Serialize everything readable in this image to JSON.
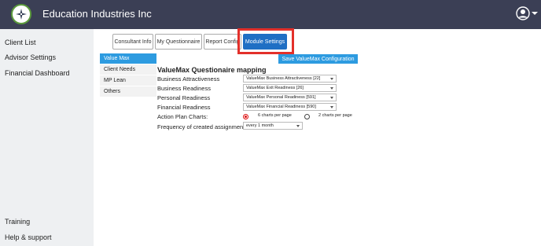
{
  "app": {
    "title": "Education Industries Inc"
  },
  "sidebar": {
    "items": [
      {
        "label": "Client List"
      },
      {
        "label": "Advisor Settings"
      },
      {
        "label": "Financial Dashboard"
      }
    ],
    "bottom_items": [
      {
        "label": "Training"
      },
      {
        "label": "Help & support"
      }
    ]
  },
  "tabs": [
    {
      "label": "Consultant Info"
    },
    {
      "label": "My Questionnaire"
    },
    {
      "label": "Report Config"
    },
    {
      "label": "Module Settings",
      "active": true
    }
  ],
  "subnav": [
    {
      "label": "Value Max",
      "active": true
    },
    {
      "label": "Client Needs"
    },
    {
      "label": "MP Lean"
    },
    {
      "label": "Others"
    }
  ],
  "main": {
    "save_label": "Save ValueMax Configuration",
    "section_title": "ValueMax Questionaire mapping",
    "mappings": [
      {
        "label": "Business Attractiveness",
        "value": "ValueMax Business Attractiveness [22]"
      },
      {
        "label": "Business Readiness",
        "value": "ValueMax Exit Readiness [26]"
      },
      {
        "label": "Personal Readiness",
        "value": "ValueMax Personal Readiness [591]"
      },
      {
        "label": "Financial Readiness",
        "value": "ValueMax Financial Readiness [590]"
      }
    ],
    "action_plan": {
      "label": "Action Plan Charts:",
      "options": [
        {
          "label": "6 charts per page",
          "checked": true
        },
        {
          "label": "2 charts per page",
          "checked": false
        }
      ]
    },
    "frequency": {
      "label": "Frequency of created assignment:",
      "value": "every 1 month"
    }
  },
  "colors": {
    "topbar": "#3b3f55",
    "accent": "#2d9be0",
    "active_tab": "#1f6fc4",
    "highlight": "#e3302a"
  }
}
